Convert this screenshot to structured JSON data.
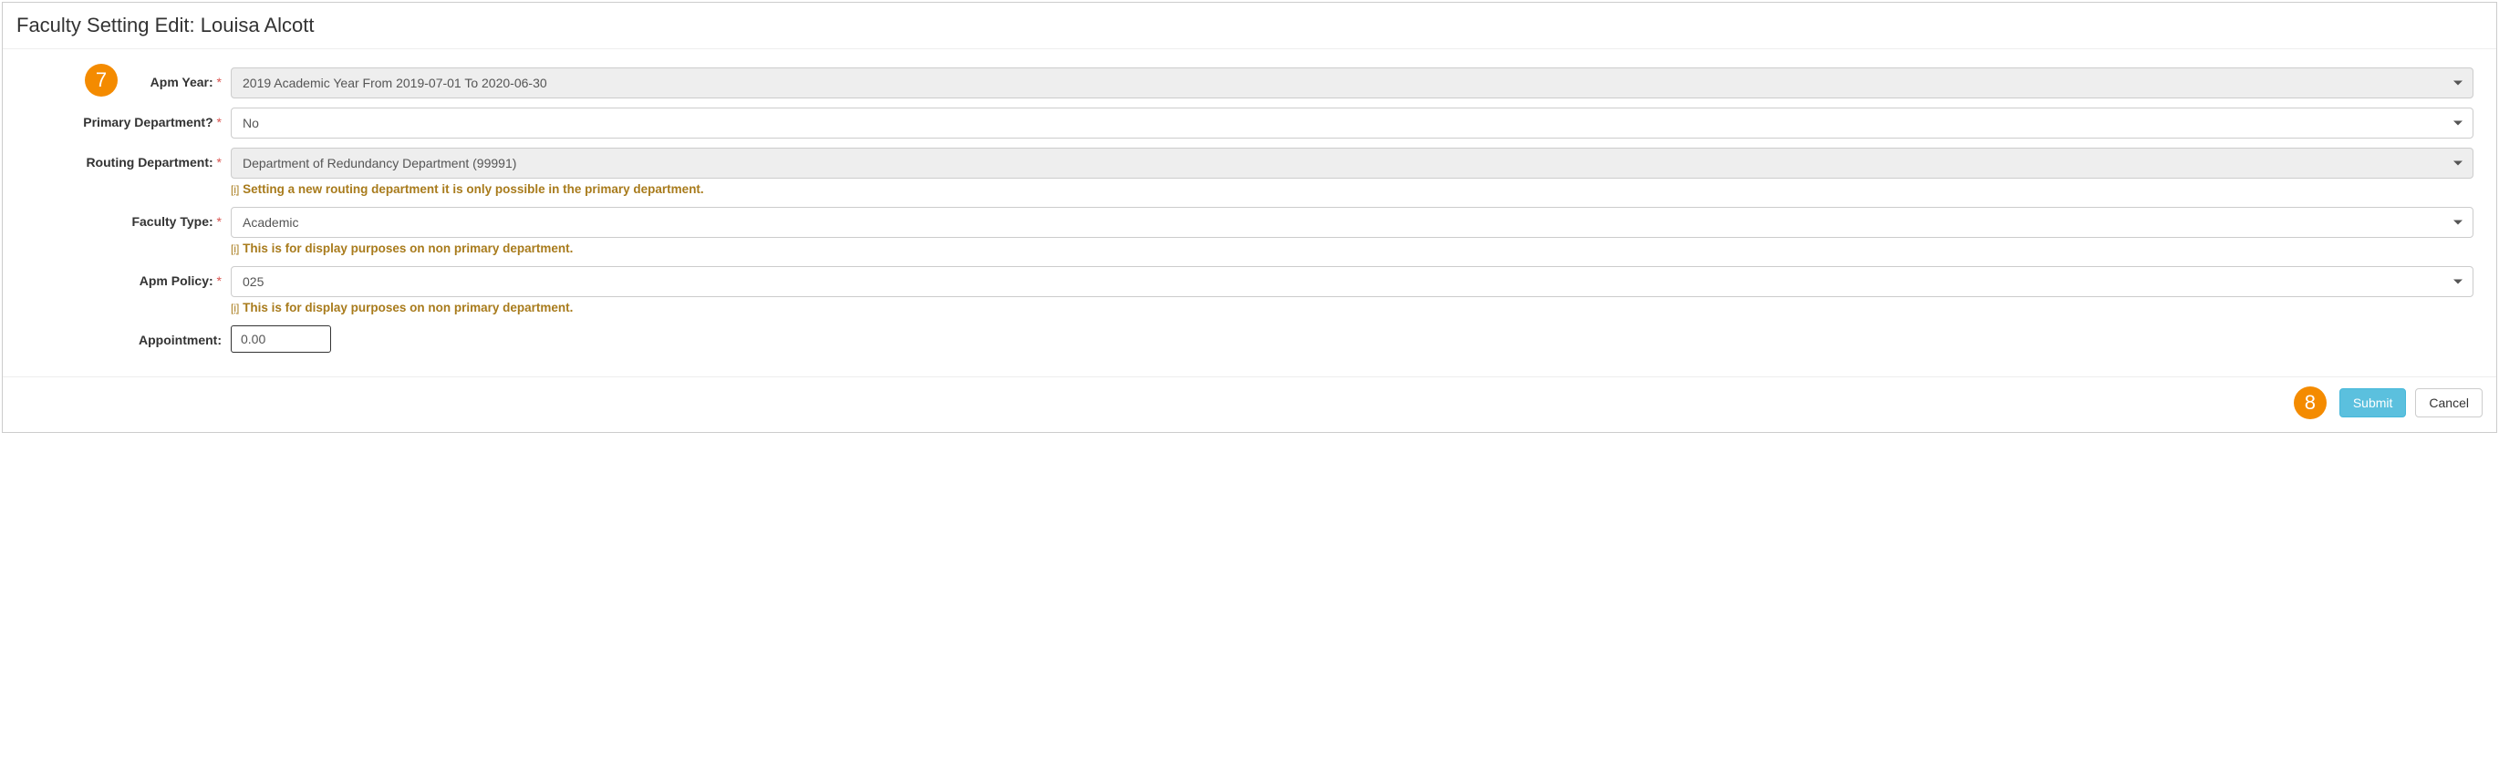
{
  "header": {
    "title": "Faculty Setting Edit: Louisa Alcott"
  },
  "markers": {
    "seven": "7",
    "eight": "8"
  },
  "form": {
    "apm_year": {
      "label": "Apm Year:",
      "required": "*",
      "value": "2019 Academic Year From 2019-07-01 To 2020-06-30"
    },
    "primary_department": {
      "label": "Primary Department?",
      "required": "*",
      "value": "No"
    },
    "routing_department": {
      "label": "Routing Department:",
      "required": "*",
      "value": "Department of Redundancy Department (99991)",
      "note_icon": "[i]",
      "note": "Setting a new routing department it is only possible in the primary department."
    },
    "faculty_type": {
      "label": "Faculty Type:",
      "required": "*",
      "value": "Academic",
      "note_icon": "[i]",
      "note": "This is for display purposes on non primary department."
    },
    "apm_policy": {
      "label": "Apm Policy:",
      "required": "*",
      "value": "025",
      "note_icon": "[i]",
      "note": "This is for display purposes on non primary department."
    },
    "appointment": {
      "label": "Appointment:",
      "value": "0.00"
    }
  },
  "buttons": {
    "submit": "Submit",
    "cancel": "Cancel"
  }
}
